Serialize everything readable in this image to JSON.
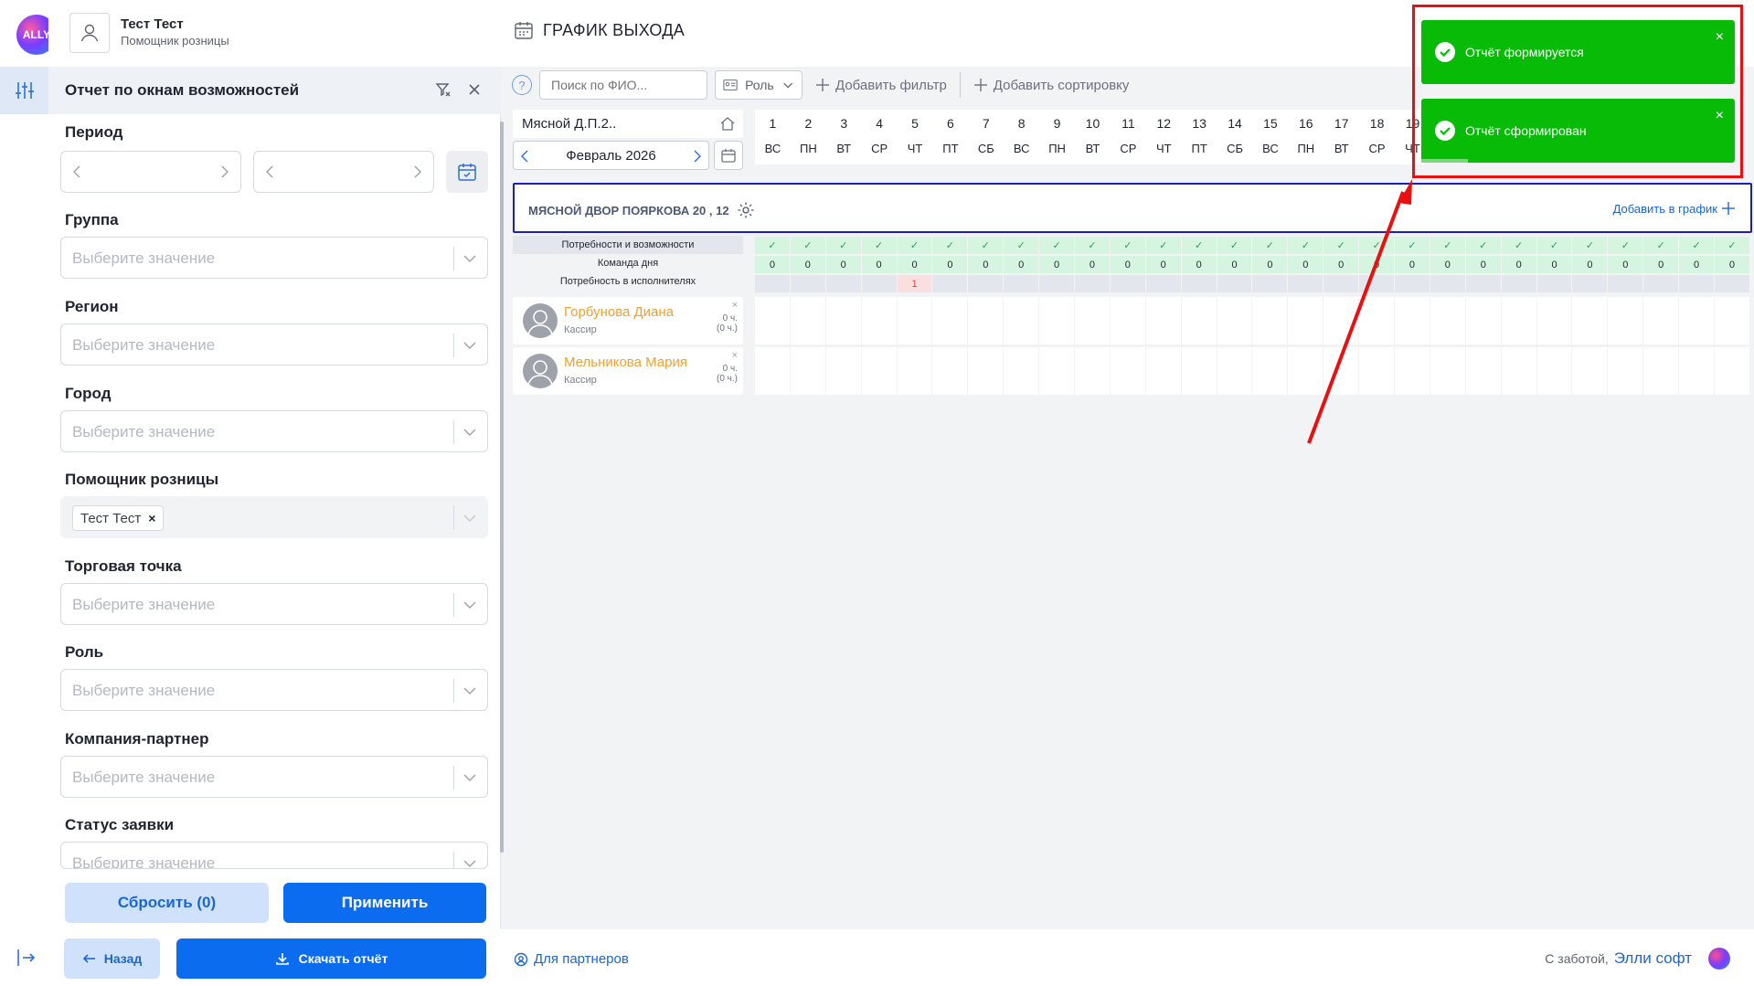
{
  "app": {
    "logo_text": "ALLY",
    "user_name": "Тест Тест",
    "user_role": "Помощник розницы",
    "page_title": "ГРАФИК ВЫХОДА"
  },
  "panel": {
    "title": "Отчет по окнам возможностей",
    "fields": {
      "period": "Период",
      "group": "Группа",
      "region": "Регион",
      "city": "Город",
      "assistant": "Помощник розницы",
      "outlet": "Торговая точка",
      "role": "Роль",
      "partner": "Компания-партнер",
      "status": "Статус заявки"
    },
    "placeholder": "Выберите значение",
    "assistant_chip": "Тест Тест",
    "chip_remove": "×",
    "reset_label": "Сбросить (0)",
    "apply_label": "Применить"
  },
  "bottom": {
    "back_label": "Назад",
    "download_label": "Скачать отчёт",
    "partners_label": "Для партнеров",
    "care_label": "С заботой,",
    "brand_label": "Элли софт"
  },
  "schedule": {
    "help": "?",
    "search_placeholder": "Поиск по ФИО...",
    "role_label": "Роль",
    "add_filter": "Добавить фильтр",
    "add_sort": "Добавить сортировку",
    "store": "Мясной Д.П.2..",
    "month": "Февраль 2026",
    "days": [
      {
        "n": "1",
        "w": "ВС"
      },
      {
        "n": "2",
        "w": "ПН"
      },
      {
        "n": "3",
        "w": "ВТ"
      },
      {
        "n": "4",
        "w": "СР"
      },
      {
        "n": "5",
        "w": "ЧТ"
      },
      {
        "n": "6",
        "w": "ПТ"
      },
      {
        "n": "7",
        "w": "СБ"
      },
      {
        "n": "8",
        "w": "ВС"
      },
      {
        "n": "9",
        "w": "ПН"
      },
      {
        "n": "10",
        "w": "ВТ"
      },
      {
        "n": "11",
        "w": "СР"
      },
      {
        "n": "12",
        "w": "ЧТ"
      },
      {
        "n": "13",
        "w": "ПТ"
      },
      {
        "n": "14",
        "w": "СБ"
      },
      {
        "n": "15",
        "w": "ВС"
      },
      {
        "n": "16",
        "w": "ПН"
      },
      {
        "n": "17",
        "w": "ВТ"
      },
      {
        "n": "18",
        "w": "СР"
      },
      {
        "n": "19",
        "w": "ЧТ"
      }
    ],
    "group_name": "МЯСНОЙ ДВОР ПОЯРКОВА 20 , 12",
    "group_add": "Добавить в график",
    "row_labels": [
      "Потребности и возможности",
      "Команда дня",
      "Потребность в исполнителях"
    ],
    "day_count": 28,
    "team_value": "0",
    "need_alert_day": 5,
    "need_alert_value": "1",
    "employees": [
      {
        "name": "Горбунова Диана",
        "role": "Кассир",
        "hours": "0 ч.",
        "hours2": "(0 ч.)"
      },
      {
        "name": "Мельникова Мария",
        "role": "Кассир",
        "hours": "0 ч.",
        "hours2": "(0 ч.)"
      }
    ]
  },
  "toasts": [
    {
      "message": "Отчёт формируется",
      "close": "×"
    },
    {
      "message": "Отчёт сформирован",
      "close": "×",
      "progress": 0.15
    }
  ],
  "colors": {
    "primary": "#0c6cf0",
    "toast_green": "#07bb07",
    "highlight_red": "#e81010",
    "group_border": "#1b1fb3",
    "employee_name": "#f0a032"
  }
}
